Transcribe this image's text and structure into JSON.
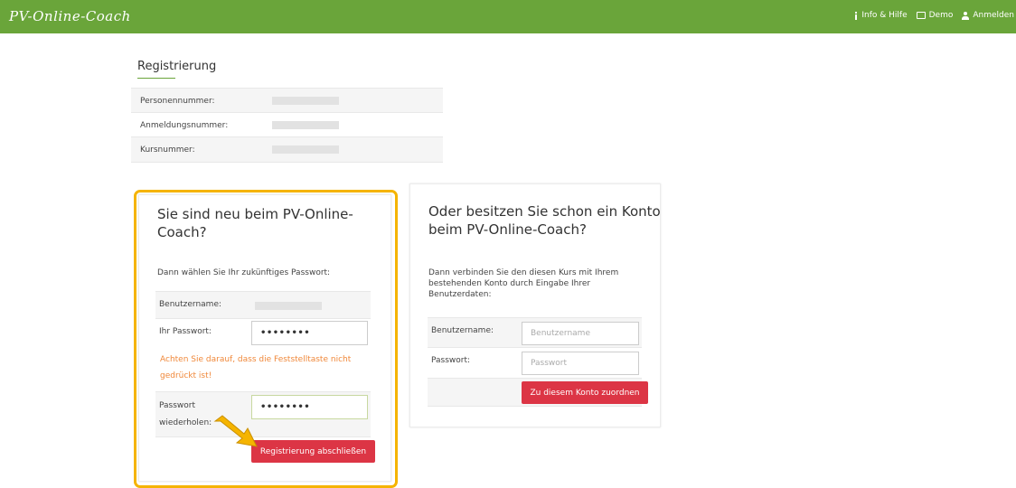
{
  "header": {
    "brand": "PV-Online-Coach",
    "nav": [
      {
        "label": "Info & Hilfe",
        "icon": "info-icon"
      },
      {
        "label": "Demo",
        "icon": "monitor-icon"
      },
      {
        "label": "Anmelden",
        "icon": "user-icon"
      }
    ]
  },
  "registration": {
    "title": "Registrierung",
    "rows": [
      {
        "label": "Personennummer:"
      },
      {
        "label": "Anmeldungsnummer:"
      },
      {
        "label": "Kursnummer:"
      }
    ]
  },
  "new_user": {
    "title": "Sie sind neu beim PV-Online-Coach?",
    "title_line1": "Sie sind neu beim PV-Online-",
    "title_line2": "Coach?",
    "intro": "Dann wählen Sie Ihr zukünftiges Passwort:",
    "username_label": "Benutzername:",
    "password_label": "Ihr Passwort:",
    "password_value": "••••••••",
    "warning": "Achten Sie darauf, dass die Feststelltaste nicht gedrückt ist!",
    "repeat_label_line1": "Passwort",
    "repeat_label_line2": "wiederholen:",
    "repeat_value": "••••••••",
    "submit_label": "Registrierung abschließen"
  },
  "existing_user": {
    "title_line1": "Oder besitzen Sie schon ein Konto",
    "title_line2": "beim PV-Online-Coach?",
    "intro_line1": "Dann verbinden Sie den diesen Kurs mit Ihrem",
    "intro_line2": "bestehenden Konto durch Eingabe Ihrer",
    "intro_line3": "Benutzerdaten:",
    "username_label": "Benutzername:",
    "username_placeholder": "Benutzername",
    "password_label": "Passwort:",
    "password_placeholder": "Passwort",
    "submit_label": "Zu diesem Konto zuordnen"
  },
  "colors": {
    "header": "#6aa53a",
    "button": "#dc3545",
    "highlight": "#f5b400",
    "warning": "#f0883a"
  }
}
